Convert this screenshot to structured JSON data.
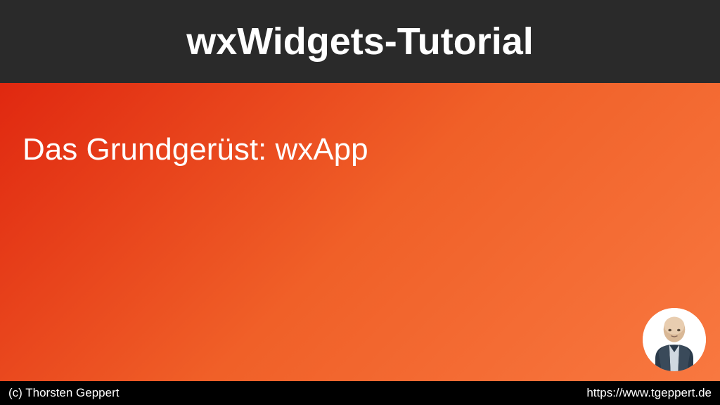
{
  "header": {
    "title": "wxWidgets-Tutorial"
  },
  "main": {
    "subtitle": "Das Grundgerüst: wxApp"
  },
  "footer": {
    "copyright": "(c) Thorsten Geppert",
    "url": "https://www.tgeppert.de"
  }
}
